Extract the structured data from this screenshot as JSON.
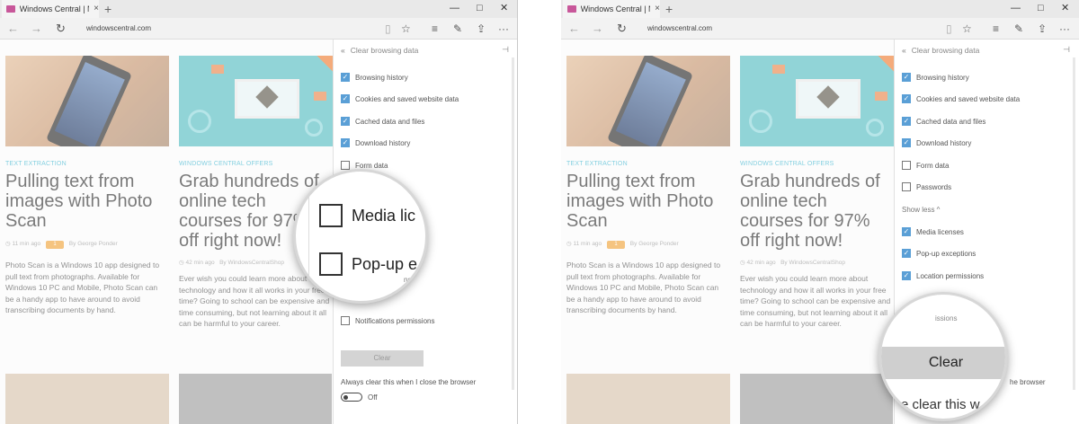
{
  "browser": {
    "tab_title": "Windows Central | New",
    "tab_close": "×",
    "new_tab": "+",
    "url": "windowscentral.com",
    "win_min": "—",
    "win_max": "□",
    "win_close": "✕"
  },
  "articles": [
    {
      "category": "TEXT EXTRACTION",
      "headline": "Pulling text from images with Photo Scan",
      "time": "11 min ago",
      "comments": "1",
      "author": "By George Ponder",
      "excerpt": "Photo Scan is a Windows 10 app designed to pull text from photographs. Available for Windows 10 PC and Mobile, Photo Scan can be a handy app to have around to avoid transcribing documents by hand."
    },
    {
      "category": "WINDOWS CENTRAL OFFERS",
      "headline": "Grab hundreds of online tech courses for 97% off right now!",
      "time": "42 min ago",
      "author": "By WindowsCentralShop",
      "excerpt": "Ever wish you could learn more about technology and how it all works in your free time? Going to school can be expensive and time consuming, but not learning about it all can be harmful to your career."
    }
  ],
  "panel": {
    "title": "Clear browsing data",
    "show_less": "Show less ^",
    "clear_label": "Clear",
    "always_clear": "Always clear this when I close the browser",
    "toggle_state": "Off",
    "left_items": [
      {
        "label": "Browsing history",
        "checked": true
      },
      {
        "label": "Cookies and saved website data",
        "checked": true
      },
      {
        "label": "Cached data and files",
        "checked": true
      },
      {
        "label": "Download history",
        "checked": true
      },
      {
        "label": "Form data",
        "checked": false
      },
      {
        "label": "Notifications permissions",
        "checked": false
      }
    ],
    "right_items": [
      {
        "label": "Browsing history",
        "checked": true
      },
      {
        "label": "Cookies and saved website data",
        "checked": true
      },
      {
        "label": "Cached data and files",
        "checked": true
      },
      {
        "label": "Download history",
        "checked": true
      },
      {
        "label": "Form data",
        "checked": false
      },
      {
        "label": "Passwords",
        "checked": false
      },
      {
        "label": "Media licenses",
        "checked": true
      },
      {
        "label": "Pop-up exceptions",
        "checked": true
      },
      {
        "label": "Location permissions",
        "checked": true
      }
    ]
  },
  "magnifier_left": {
    "row1": "Media lic",
    "row2": "Pop-up e",
    "faint1": "ns",
    "faint2": "ermissions"
  },
  "magnifier_right": {
    "top_faint": "issions",
    "clear": "Clear",
    "bottom": "e clear this w",
    "side": "he browser"
  },
  "colors": {
    "accent": "#5a9fd6",
    "category": "#3fb5cf",
    "comment_badge": "#f0a53d"
  }
}
